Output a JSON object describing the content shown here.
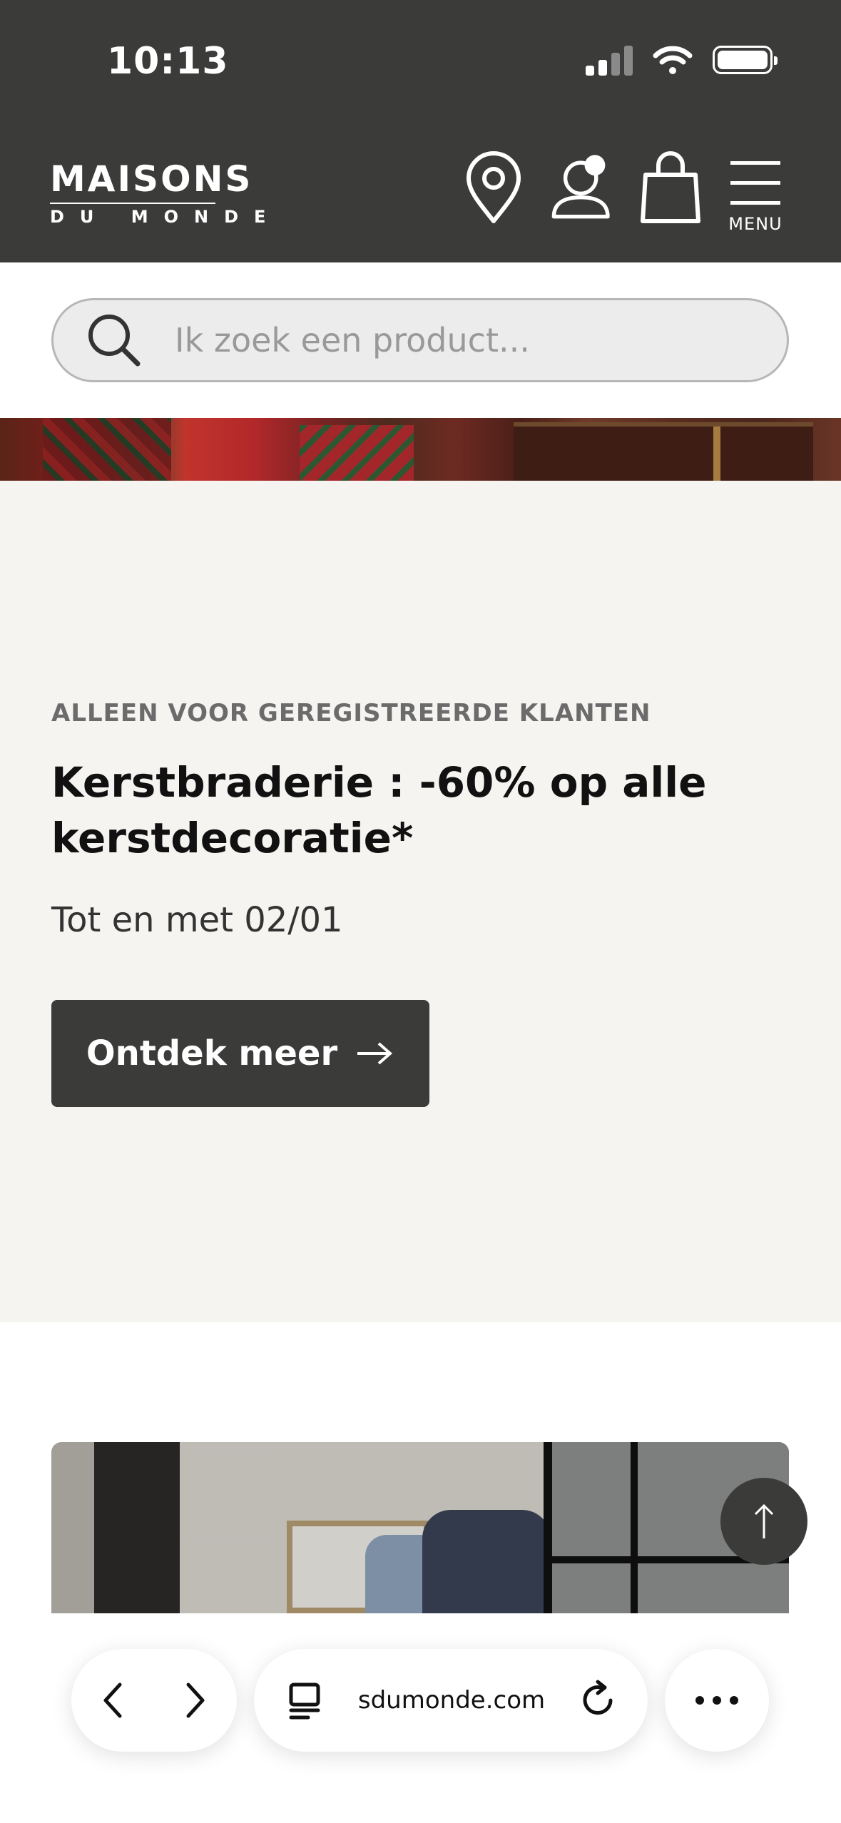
{
  "status_bar": {
    "time": "10:13",
    "icons": [
      "cellular-signal-icon",
      "wifi-icon",
      "battery-icon"
    ]
  },
  "header": {
    "logo_top": "MAISONS",
    "logo_bottom": "DU MONDE",
    "icons": [
      "store-locator-icon",
      "account-icon",
      "cart-icon",
      "menu-icon"
    ],
    "menu_label": "MENU",
    "background": "#3b3b3a"
  },
  "search": {
    "placeholder": "Ik zoek een product..."
  },
  "promo": {
    "eyebrow": "ALLEEN VOOR GEREGISTREERDE KLANTEN",
    "title": "Kerstbraderie : -60% op alle kerstdecoratie*",
    "subtitle": "Tot en met 02/01",
    "cta_label": "Ontdek meer",
    "background": "#f5f4f1"
  },
  "browser": {
    "url": "sdumonde.com",
    "icons": [
      "back-icon",
      "forward-icon",
      "tabs-icon",
      "reload-icon",
      "more-icon"
    ]
  }
}
